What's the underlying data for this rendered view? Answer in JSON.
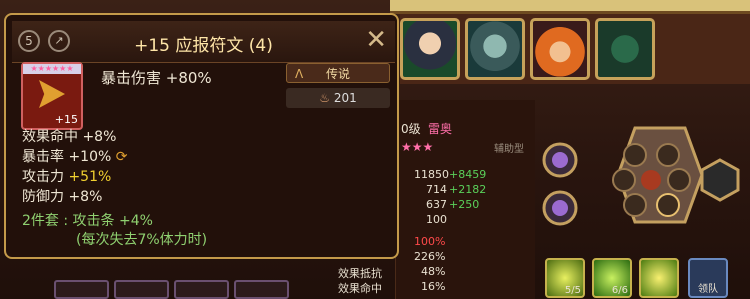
{
  "tooltip": {
    "level_badge": "5",
    "title": "+15 应报符文 (4)",
    "rune_level": "+15",
    "main_stat": "暴击伤害 +80%",
    "grade_label": "传说",
    "value_label": "201",
    "substats": [
      {
        "name": "效果命中",
        "value": "+8%"
      },
      {
        "name": "暴击率",
        "value": "+10%"
      },
      {
        "name": "攻击力",
        "value": "+51%"
      },
      {
        "name": "防御力",
        "value": "+8%"
      }
    ],
    "set_bonus": "2件套 : 攻击条 +4%",
    "set_note": "(每次失去7%体力时)"
  },
  "hero_panel": {
    "level_text": "0级",
    "name": "雷奥",
    "role": "辅助型",
    "stats": [
      {
        "base": "11850",
        "bonus": "+8459"
      },
      {
        "base": "714",
        "bonus": "+2182"
      },
      {
        "base": "637",
        "bonus": "+250"
      },
      {
        "base": "100",
        "bonus": ""
      }
    ],
    "crit_dmg": "100%",
    "val2": "226%",
    "resist_label": "效果抵抗",
    "resist_value": "48%",
    "hit_label": "效果命中",
    "hit_value": "16%"
  },
  "skills": [
    "5/5",
    "6/6"
  ],
  "team_button": "领队",
  "colors": {
    "gold": "#c49a4a",
    "green": "#5ad05a",
    "red": "#ff4a4a"
  }
}
